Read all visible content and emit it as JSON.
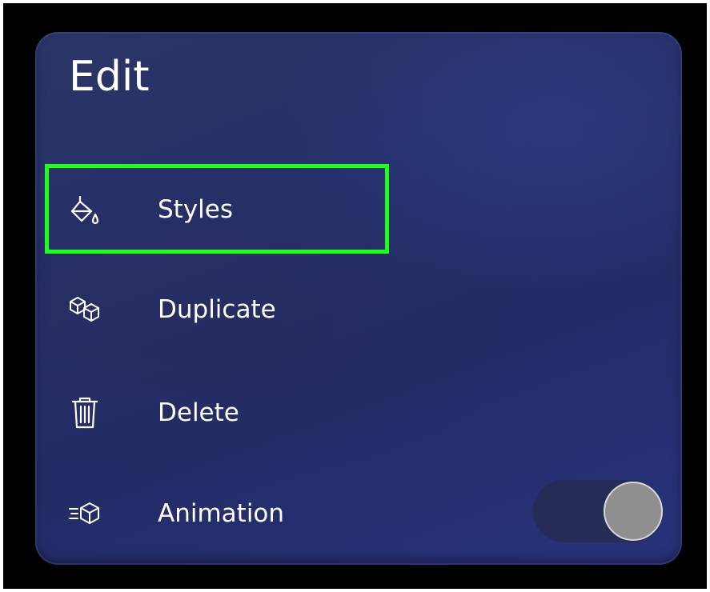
{
  "panel": {
    "title": "Edit"
  },
  "menu": {
    "items": [
      {
        "label": "Styles",
        "icon": "paint-bucket-icon",
        "focused": true
      },
      {
        "label": "Duplicate",
        "icon": "duplicate-cubes-icon"
      },
      {
        "label": "Delete",
        "icon": "trash-icon"
      },
      {
        "label": "Animation",
        "icon": "animation-cube-icon",
        "toggle_on": true
      }
    ]
  },
  "colors": {
    "focus_outline": "#1dff1d",
    "panel_background": "#252f68",
    "text": "#ffffff"
  }
}
